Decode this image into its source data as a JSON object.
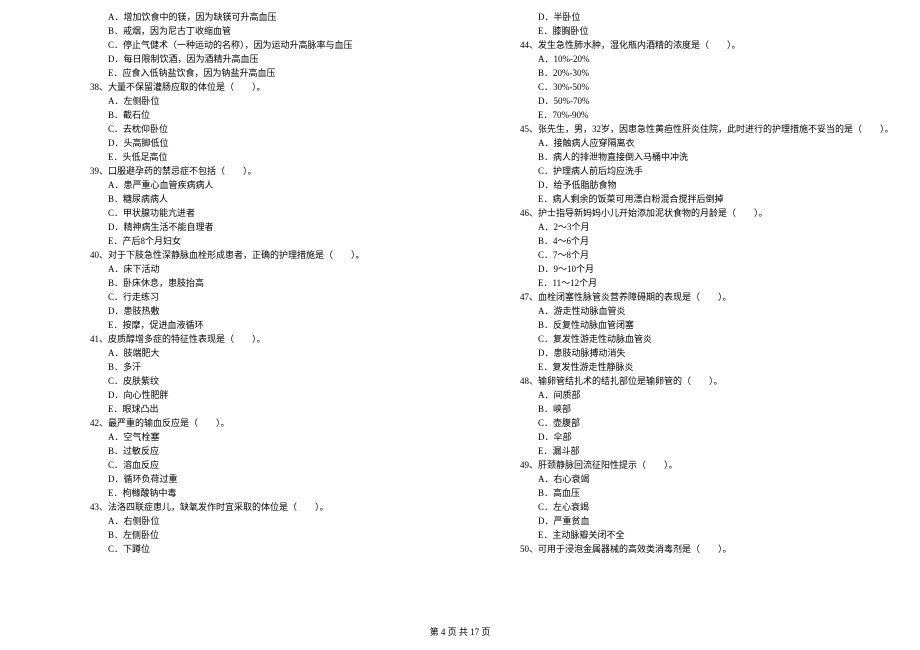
{
  "left": {
    "q37_opts": [
      "A．增加饮食中的镁，因为缺镁可升高血压",
      "B．戒烟，因为尼古丁收缩血管",
      "C．停止气健术（一种运动的名称），因为运动升高脉率与血压",
      "D．每日限制饮酒，因为酒精升高血压",
      "E．应食入低钠盐饮食，因为钠盐升高血压"
    ],
    "q38": "38、大量不保留灌肠应取的体位是（　　）。",
    "q38_opts": [
      "A．左侧卧位",
      "B．截石位",
      "C．去枕仰卧位",
      "D．头高脚低位",
      "E．头低足高位"
    ],
    "q39": "39、口服避孕药的禁忌症不包括（　　）。",
    "q39_opts": [
      "A．患严重心血管疾病病人",
      "B．糖尿病病人",
      "C．甲状腺功能亢进者",
      "D．精神病生活不能自理者",
      "E．产后8个月妇女"
    ],
    "q40": "40、对于下肢急性深静脉血栓形成患者，正确的护理措施是（　　）。",
    "q40_opts": [
      "A．床下活动",
      "B．卧床休息，患肢抬高",
      "C．行走练习",
      "D．患肢热敷",
      "E．按摩，促进血液循环"
    ],
    "q41": "41、皮质醇增多症的特征性表现是（　　）。",
    "q41_opts": [
      "A．肢端肥大",
      "B．多汗",
      "C．皮肤紫纹",
      "D．向心性肥胖",
      "E．眼球凸出"
    ],
    "q42": "42、最严重的输血反应是（　　）。",
    "q42_opts": [
      "A．空气栓塞",
      "B．过敏反应",
      "C．溶血反应",
      "D．循环负荷过重",
      "E．枸橼酸钠中毒"
    ],
    "q43": "43、法洛四联症患儿，缺氧发作时宜采取的体位是（　　）。",
    "q43_opts": [
      "A．右侧卧位",
      "B．左侧卧位",
      "C．下蹲位"
    ]
  },
  "right": {
    "q43_opts": [
      "D．半卧位",
      "E．膝胸卧位"
    ],
    "q44": "44、发生急性肺水肿，湿化瓶内酒精的浓度是（　　）。",
    "q44_opts": [
      "A．10%-20%",
      "B．20%-30%",
      "C．30%-50%",
      "D．50%-70%",
      "E．70%-90%"
    ],
    "q45": "45、张先生，男，32岁，因患急性黄疸性肝炎住院，此时进行的护理措施不妥当的是（　　）。",
    "q45_opts": [
      "A．接触病人应穿隔离衣",
      "B．病人的排泄物直接倒入马桶中冲洗",
      "C．护理病人前后均应洗手",
      "D．给予低脂肪食物",
      "E．病人剩余的饭菜可用漂白粉混合搅拌后倒掉"
    ],
    "q46": "46、护士指导新妈妈小儿开始添加泥状食物的月龄是（　　）。",
    "q46_opts": [
      "A．2～3个月",
      "B．4～6个月",
      "C．7～8个月",
      "D．9～10个月",
      "E．11～12个月"
    ],
    "q47": "47、血栓闭塞性脉管炎营养障碍期的表现是（　　）。",
    "q47_opts": [
      "A．游走性动脉血管炎",
      "B．反复性动脉血管闭塞",
      "C．复发性游走性动脉血管炎",
      "D．患肢动脉搏动消失",
      "E．复发性游走性静脉炎"
    ],
    "q48": "48、输卵管结扎术的结扎部位是输卵管的（　　）。",
    "q48_opts": [
      "A．间质部",
      "B．峡部",
      "C．壶腹部",
      "D．伞部",
      "E．漏斗部"
    ],
    "q49": "49、肝颈静脉回流征阳性提示（　　）。",
    "q49_opts": [
      "A．右心衰竭",
      "B．高血压",
      "C．左心衰竭",
      "D．严重贫血",
      "E．主动脉瓣关闭不全"
    ],
    "q50": "50、可用于浸泡金属器械的高效类消毒剂是（　　）。"
  },
  "footer": "第 4 页 共 17 页"
}
